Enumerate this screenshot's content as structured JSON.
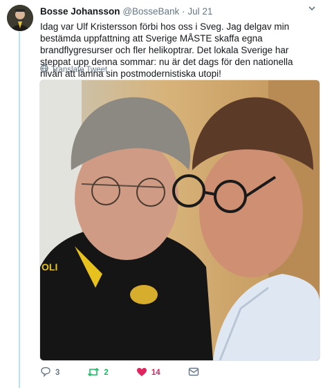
{
  "tweet": {
    "name": "Bosse Johansson",
    "handle": "@BosseBank",
    "separator": "·",
    "date": "Jul 21",
    "text": "Idag var Ulf Kristersson förbi hos oss i Sveg. Jag delgav min bestämda uppfattning att Sverige MÅSTE skaffa egna brandflygresurser och fler helikoptrar. Det lokala Sverige har steppat upp denna sommar: nu är det dags för den nationella nivån att lämna sin postmodernistiska utopi!",
    "translate_label": "Translate Tweet",
    "shirt_text": "OLI"
  },
  "actions": {
    "reply_count": "3",
    "retweet_count": "2",
    "like_count": "14"
  },
  "colors": {
    "accent": "#1da1f2",
    "retweet": "#17bf63",
    "like": "#e0245e",
    "muted": "#657786",
    "thread_line": "#b6e2f9"
  },
  "icons": [
    "chevron-down-icon",
    "globe-icon",
    "reply-icon",
    "retweet-icon",
    "heart-icon",
    "message-icon"
  ]
}
